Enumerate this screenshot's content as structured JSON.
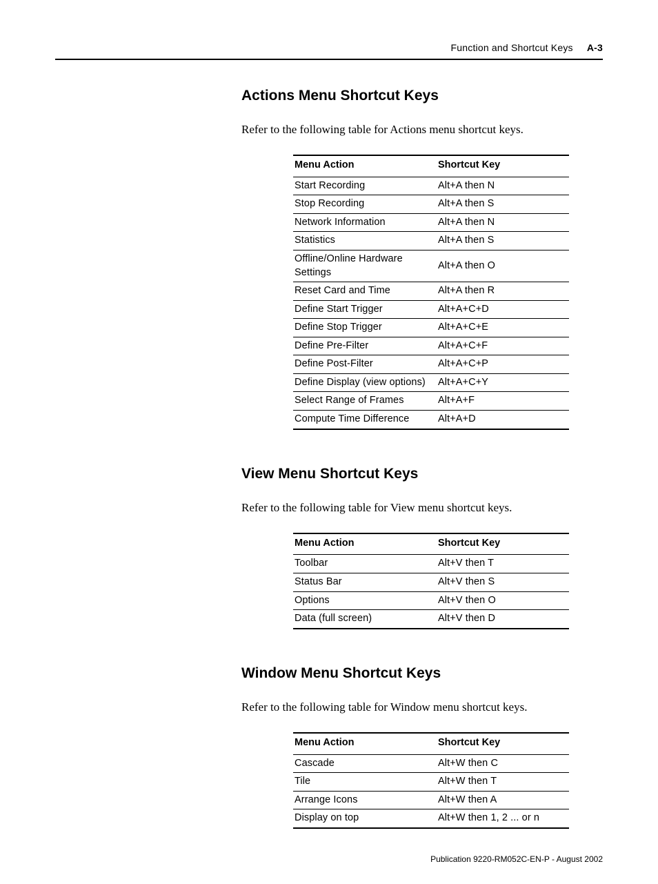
{
  "header": {
    "title": "Function and Shortcut Keys",
    "page_number": "A-3"
  },
  "sections": [
    {
      "heading": "Actions Menu Shortcut Keys",
      "intro": "Refer to the following table for Actions menu shortcut keys.",
      "table": {
        "col1": "Menu Action",
        "col2": "Shortcut Key",
        "rows": [
          {
            "action": "Start Recording",
            "shortcut": "Alt+A then N"
          },
          {
            "action": "Stop Recording",
            "shortcut": "Alt+A then S"
          },
          {
            "action": "Network Information",
            "shortcut": "Alt+A then N"
          },
          {
            "action": "Statistics",
            "shortcut": "Alt+A then S"
          },
          {
            "action": "Offline/Online Hardware Settings",
            "shortcut": "Alt+A then O"
          },
          {
            "action": "Reset Card and Time",
            "shortcut": "Alt+A then R"
          },
          {
            "action": "Define Start Trigger",
            "shortcut": "Alt+A+C+D"
          },
          {
            "action": "Define Stop Trigger",
            "shortcut": "Alt+A+C+E"
          },
          {
            "action": "Define Pre-Filter",
            "shortcut": "Alt+A+C+F"
          },
          {
            "action": "Define Post-Filter",
            "shortcut": "Alt+A+C+P"
          },
          {
            "action": "Define Display (view options)",
            "shortcut": "Alt+A+C+Y"
          },
          {
            "action": "Select Range of Frames",
            "shortcut": "Alt+A+F"
          },
          {
            "action": "Compute Time Difference",
            "shortcut": "Alt+A+D"
          }
        ]
      }
    },
    {
      "heading": "View Menu Shortcut Keys",
      "intro": "Refer to the following table for View menu shortcut keys.",
      "table": {
        "col1": "Menu Action",
        "col2": "Shortcut Key",
        "rows": [
          {
            "action": "Toolbar",
            "shortcut": "Alt+V then T"
          },
          {
            "action": "Status Bar",
            "shortcut": "Alt+V then S"
          },
          {
            "action": "Options",
            "shortcut": "Alt+V then O"
          },
          {
            "action": "Data (full screen)",
            "shortcut": "Alt+V then D"
          }
        ]
      }
    },
    {
      "heading": "Window Menu Shortcut Keys",
      "intro": "Refer to the following table for Window menu shortcut keys.",
      "table": {
        "col1": "Menu Action",
        "col2": "Shortcut Key",
        "rows": [
          {
            "action": "Cascade",
            "shortcut": "Alt+W then C"
          },
          {
            "action": "Tile",
            "shortcut": "Alt+W then T"
          },
          {
            "action": "Arrange Icons",
            "shortcut": "Alt+W then A"
          },
          {
            "action": "Display on top",
            "shortcut": "Alt+W then 1, 2 ... or n"
          }
        ]
      }
    }
  ],
  "footer": {
    "publication": "Publication 9220-RM052C-EN-P - August 2002"
  }
}
